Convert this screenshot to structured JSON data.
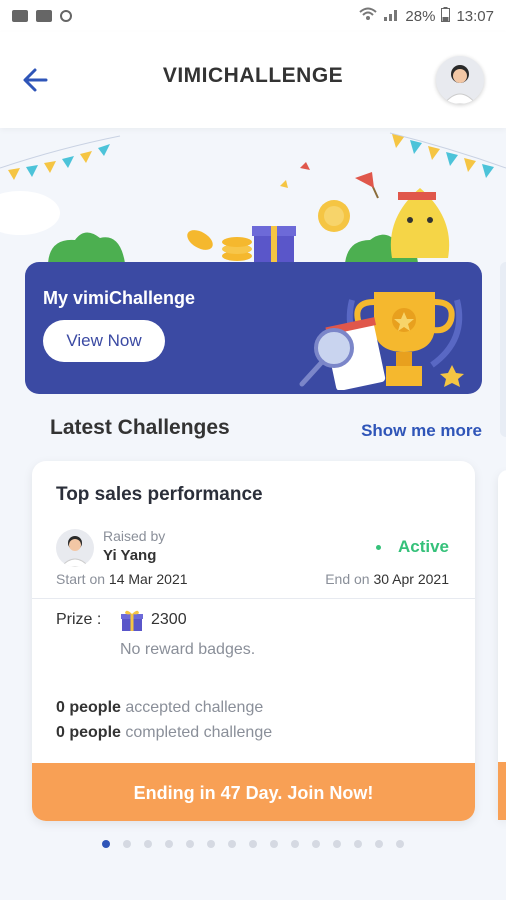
{
  "status_bar": {
    "battery": "28%",
    "time": "13:07"
  },
  "header": {
    "title": "VIMICHALLENGE"
  },
  "banner": {
    "title": "My vimiChallenge",
    "button": "View Now"
  },
  "latest": {
    "title": "Latest Challenges",
    "show_more": "Show me more"
  },
  "challenge": {
    "title": "Top sales performance",
    "raised_by_label": "Raised by",
    "raiser": "Yi Yang",
    "status": "Active",
    "start_label": "Start on",
    "start_date": "14 Mar 2021",
    "end_label": "End on",
    "end_date": "30 Apr 2021",
    "prize_label": "Prize :",
    "prize_value": "2300",
    "no_badges": "No reward badges.",
    "accepted_count": "0 people",
    "accepted_text": "accepted challenge",
    "completed_count": "0 people",
    "completed_text": "completed challenge",
    "cta": "Ending in 47 Day. Join Now!"
  },
  "pagination": {
    "total": 15,
    "current": 1
  },
  "colors": {
    "primary": "#3b4aa3",
    "link": "#2f55b8",
    "active": "#35c17a",
    "cta": "#f8a055"
  }
}
